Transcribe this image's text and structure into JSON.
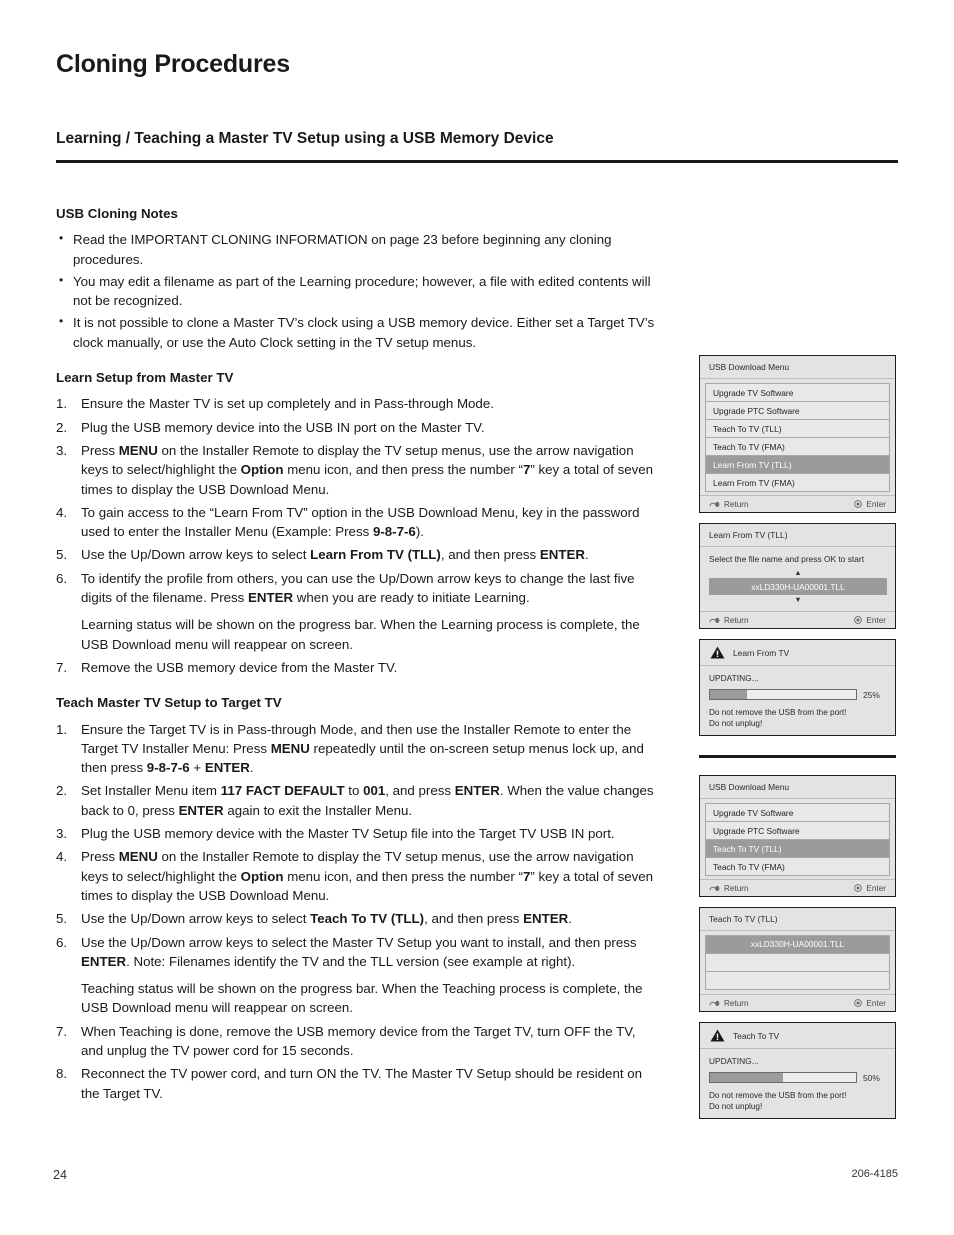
{
  "document": {
    "chapter_title": "Cloning Procedures",
    "section_title": "Learning / Teaching a Master TV Setup using a USB Memory Device",
    "page_number": "24",
    "doc_code": "206-4185"
  },
  "notes": {
    "heading": "USB Cloning Notes",
    "items": [
      "Read the IMPORTANT CLONING INFORMATION on page 23 before beginning any cloning procedures.",
      "You may edit a filename as part of the Learning procedure; however, a file with edited contents will not be recognized.",
      "It is not possible to clone a Master TV’s clock using a USB memory device. Either set a Target TV’s clock manually, or use the Auto Clock setting in the TV setup menus."
    ]
  },
  "learn_section": {
    "heading": "Learn Setup from Master TV",
    "steps": [
      "Ensure the Master TV is set up completely and in Pass-through Mode.",
      "Plug the USB memory device into the USB IN port on the Master TV.",
      "Press MENU on the Installer Remote to display the TV setup menus, use the arrow navigation keys to select/highlight the Option menu icon, and then press the number “7” key a total of seven times to display the USB Download Menu.",
      "To gain access to the “Learn From TV” option in the USB Download Menu, key in the password used to enter the Installer Menu (Example: Press 9-8-7-6).",
      "Use the Up/Down arrow keys to select Learn From TV (TLL), and then press ENTER.",
      "To identify the profile from others, you can use the Up/Down arrow keys to change the last five digits of the filename. Press ENTER when you are ready to initiate Learning.",
      "Remove the USB memory device from the Master TV."
    ],
    "step6_continuation": "Learning status will be shown on the progress bar. When the Learning process is complete, the USB Download menu will reappear on screen."
  },
  "teach_section": {
    "heading": "Teach Master TV Setup to Target TV",
    "steps": [
      "Ensure the Target TV is in Pass-through Mode, and then use the Installer Remote to enter the Target TV Installer Menu: Press MENU repeatedly until the on-screen setup menus lock up, and then press 9-8-7-6 + ENTER.",
      "Set Installer Menu item 117 FACT DEFAULT to 001, and press ENTER. When the value changes back to 0, press ENTER again to exit the Installer Menu.",
      "Plug the USB memory device with the Master TV Setup file into the Target TV USB IN port.",
      "Press MENU on the Installer Remote to display the TV setup menus, use the arrow navigation keys to select/highlight the Option menu icon, and then press the number “7” key a total of seven times to display the USB Download Menu.",
      "Use the Up/Down arrow keys to select Teach To TV (TLL), and then press ENTER.",
      "Use the Up/Down arrow keys to select the Master TV Setup you want to install, and then press ENTER. Note: Filenames identify the TV and the TLL version (see example at right).",
      "When Teaching is done, remove the USB memory device from the Target TV, turn OFF the TV, and unplug the TV power cord for 15 seconds.",
      "Reconnect the TV power cord, and turn ON the TV. The Master TV Setup should be resident on the Target TV."
    ],
    "step6_continuation": "Teaching status will be shown on the progress bar. When the Teaching process is complete, the USB Download menu will reappear on screen."
  },
  "panels": {
    "footer_return": "Return",
    "footer_enter": "Enter",
    "learn_menu": {
      "title": "USB Download Menu",
      "items": [
        {
          "label": "Upgrade TV Software",
          "selected": false
        },
        {
          "label": "Upgrade PTC Software",
          "selected": false
        },
        {
          "label": "Teach To TV (TLL)",
          "selected": false
        },
        {
          "label": "Teach To TV (FMA)",
          "selected": false
        },
        {
          "label": "Learn From TV (TLL)",
          "selected": true
        },
        {
          "label": "Learn From TV (FMA)",
          "selected": false
        }
      ]
    },
    "learn_file": {
      "title": "Learn From TV (TLL)",
      "prompt": "Select the file name and press OK to start",
      "up_arrow": "▲",
      "down_arrow": "▼",
      "filename": "xxLD330H-UA00001.TLL"
    },
    "learn_progress": {
      "title": "Learn From TV",
      "status": "UPDATING...",
      "percent_label": "25%",
      "percent_value": 25,
      "warning_line1": "Do not remove the USB from the port!",
      "warning_line2": "Do not unplug!"
    },
    "teach_menu": {
      "title": "USB Download Menu",
      "items": [
        {
          "label": "Upgrade TV Software",
          "selected": false
        },
        {
          "label": "Upgrade PTC Software",
          "selected": false
        },
        {
          "label": "Teach To TV (TLL)",
          "selected": true
        },
        {
          "label": "Teach To TV (FMA)",
          "selected": false
        }
      ]
    },
    "teach_file": {
      "title": "Teach To TV (TLL)",
      "rows": [
        {
          "label": "xxLD330H-UA00001.TLL",
          "selected": true
        },
        {
          "label": "",
          "selected": false
        },
        {
          "label": "",
          "selected": false
        }
      ]
    },
    "teach_progress": {
      "title": "Teach To TV",
      "status": "UPDATING...",
      "percent_label": "50%",
      "percent_value": 50,
      "warning_line1": "Do not remove the USB from the port!",
      "warning_line2": "Do not unplug!"
    }
  },
  "colors": {
    "highlight": "#9b9b9b",
    "panel_bg": "#e3e3e3",
    "rule": "#1a1a1a"
  }
}
